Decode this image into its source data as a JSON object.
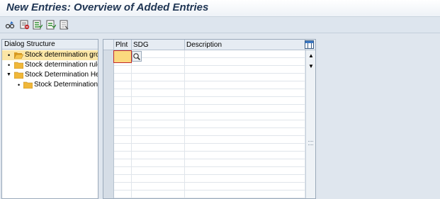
{
  "window": {
    "title": "New Entries: Overview of Added Entries"
  },
  "toolbar": {
    "buttons": [
      {
        "icon": "glasses-edit-icon"
      },
      {
        "icon": "delete-row-icon"
      },
      {
        "icon": "select-all-icon"
      },
      {
        "icon": "select-block-icon"
      },
      {
        "icon": "deselect-icon"
      }
    ]
  },
  "dialog_structure": {
    "header": "Dialog Structure",
    "items": [
      {
        "label": "Stock determination gro",
        "level": 0,
        "selected": true,
        "open": true
      },
      {
        "label": "Stock determination rule",
        "level": 0,
        "selected": false,
        "open": false
      },
      {
        "label": "Stock Determination He",
        "level": 0,
        "selected": false,
        "open": true,
        "expanded": true
      },
      {
        "label": "Stock Determination",
        "level": 1,
        "selected": false,
        "open": false
      }
    ]
  },
  "table": {
    "columns": [
      "Plnt",
      "SDG",
      "Description"
    ],
    "row_count": 19,
    "rows": []
  },
  "colors": {
    "title": "#1f3553",
    "selected_tree_item": "#fbe6a6",
    "active_cell": "#fbd97e",
    "folder": "#f0b73a"
  }
}
